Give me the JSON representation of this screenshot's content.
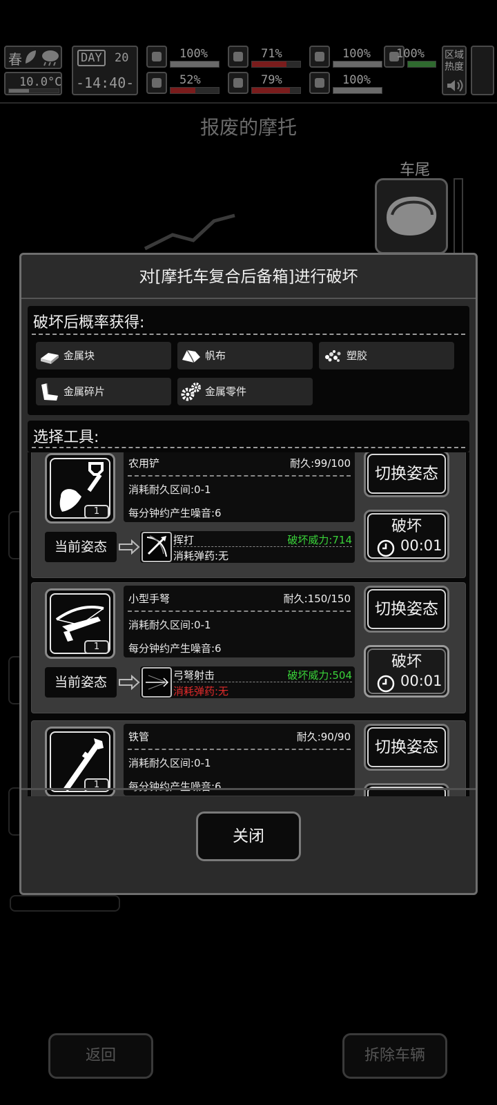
{
  "status": {
    "season": "春",
    "temperature": "10.0°C",
    "day_label": "DAY",
    "day_number": "20",
    "time": "-14:40-",
    "stats": [
      {
        "name": "medkit-icon",
        "value": "100%",
        "fill": 1.0,
        "color": "#6a6a6a"
      },
      {
        "name": "stomach-icon",
        "value": "71%",
        "fill": 0.71,
        "color": "#7a1c1c"
      },
      {
        "name": "jar-icon",
        "value": "100%",
        "fill": 1.0,
        "color": "#6a6a6a"
      },
      {
        "name": "flask-icon",
        "value": "100%",
        "fill": 1.0,
        "color": "#2f6a2f"
      },
      {
        "name": "brain-icon",
        "value": "52%",
        "fill": 0.52,
        "color": "#7a1c1c"
      },
      {
        "name": "water-drop-icon",
        "value": "79%",
        "fill": 0.79,
        "color": "#7a1c1c"
      },
      {
        "name": "heart-icon",
        "value": "100%",
        "fill": 1.0,
        "color": "#6a6a6a"
      }
    ],
    "area_heat_label": "区域热度"
  },
  "background": {
    "title": "报废的摩托",
    "tail_label": "车尾",
    "back_button": "返回",
    "dismantle_button": "拆除车辆"
  },
  "modal": {
    "title": "对[摩托车复合后备箱]进行破坏",
    "drops_header": "破坏后概率获得:",
    "drops": [
      {
        "icon": "metal-block-icon",
        "label": "金属块"
      },
      {
        "icon": "canvas-icon",
        "label": "帆布"
      },
      {
        "icon": "plastic-icon",
        "label": "塑胶"
      },
      {
        "icon": "metal-scrap-icon",
        "label": "金属碎片"
      },
      {
        "icon": "metal-parts-icon",
        "label": "金属零件"
      }
    ],
    "tools_header": "选择工具:",
    "tools": [
      {
        "icon": "shovel-icon",
        "name": "农用铲",
        "durability": "耐久:99/100",
        "count": "1",
        "wear_range": "消耗耐久区间:0-1",
        "noise": "每分钟约产生噪音:6",
        "stance_label": "当前姿态",
        "stance_icon": "swing-icon",
        "stance_name": "挥打",
        "power": "破坏威力:714",
        "ammo": "消耗弹药:无",
        "ammo_red": false,
        "switch_label": "切换姿态",
        "break_label": "破坏",
        "break_time": "00:01"
      },
      {
        "icon": "crossbow-icon",
        "name": "小型手弩",
        "durability": "耐久:150/150",
        "count": "1",
        "wear_range": "消耗耐久区间:0-1",
        "noise": "每分钟约产生噪音:6",
        "stance_label": "当前姿态",
        "stance_icon": "crossbow-shot-icon",
        "stance_name": "弓弩射击",
        "power": "破坏威力:504",
        "ammo": "消耗弹药:无",
        "ammo_red": true,
        "switch_label": "切换姿态",
        "break_label": "破坏",
        "break_time": "00:01"
      },
      {
        "icon": "iron-pipe-icon",
        "name": "铁管",
        "durability": "耐久:90/90",
        "count": "1",
        "wear_range": "消耗耐久区间:0-1",
        "noise": "每分钟约产生噪音:6",
        "switch_label": "切换姿态"
      }
    ],
    "close_label": "关闭"
  }
}
